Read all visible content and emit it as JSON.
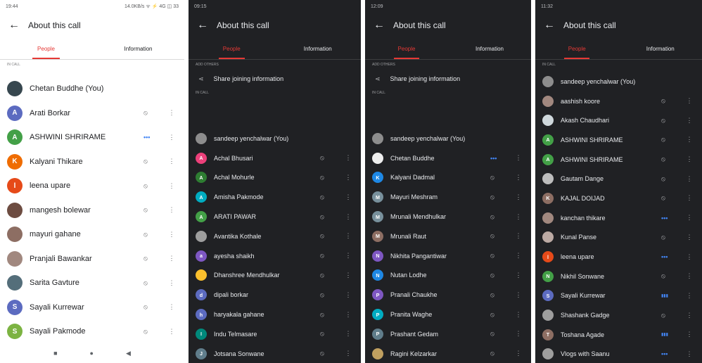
{
  "screens": [
    {
      "theme": "light",
      "status_left": "19:44",
      "status_right": "14.0KB/s ᯤ ⚡ 4G ◫ 33",
      "title": "About this call",
      "tabs": [
        "People",
        "Information"
      ],
      "share_label": "",
      "section_top": "IN CALL",
      "section_in_call": "",
      "participants": [
        {
          "name": "Chetan Buddhe (You)",
          "initial": "",
          "color": "#37474f",
          "status": ""
        },
        {
          "name": "Arati Borkar",
          "initial": "A",
          "color": "#5c6bc0",
          "status": "muted"
        },
        {
          "name": "ASHWINI SHRIRAME",
          "initial": "A",
          "color": "#43a047",
          "status": "speaking"
        },
        {
          "name": "Kalyani Thikare",
          "initial": "K",
          "color": "#ef6c00",
          "status": "muted"
        },
        {
          "name": "leena upare",
          "initial": "l",
          "color": "#e64a19",
          "status": "muted"
        },
        {
          "name": "mangesh bolewar",
          "initial": "",
          "color": "#6d4c41",
          "status": "muted"
        },
        {
          "name": "mayuri gahane",
          "initial": "",
          "color": "#8d6e63",
          "status": "muted"
        },
        {
          "name": "Pranjali Bawankar",
          "initial": "",
          "color": "#a1887f",
          "status": "muted"
        },
        {
          "name": "Sarita Gavture",
          "initial": "",
          "color": "#546e7a",
          "status": "muted"
        },
        {
          "name": "Sayali Kurrewar",
          "initial": "S",
          "color": "#5c6bc0",
          "status": "muted"
        },
        {
          "name": "Sayali Pakmode",
          "initial": "S",
          "color": "#7cb342",
          "status": "muted"
        }
      ]
    },
    {
      "theme": "dark",
      "status_left": "09:15",
      "status_right": "",
      "title": "About this call",
      "tabs": [
        "People",
        "Information"
      ],
      "section_top": "ADD OTHERS",
      "share_label": "Share joining information",
      "section_in_call": "IN CALL",
      "participants": [
        {
          "name": "sandeep yenchalwar (You)",
          "initial": "",
          "color": "#8d8d8d",
          "status": ""
        },
        {
          "name": "Achal Bhusari",
          "initial": "A",
          "color": "#ec407a",
          "status": "muted"
        },
        {
          "name": "Achal Mohurle",
          "initial": "A",
          "color": "#2e7d32",
          "status": "muted"
        },
        {
          "name": "Amisha Pakmode",
          "initial": "A",
          "color": "#00acc1",
          "status": "muted"
        },
        {
          "name": "ARATI PAWAR",
          "initial": "A",
          "color": "#43a047",
          "status": "muted"
        },
        {
          "name": "Avantika Kothale",
          "initial": "",
          "color": "#9e9e9e",
          "status": "muted"
        },
        {
          "name": "ayesha shaikh",
          "initial": "a",
          "color": "#7e57c2",
          "status": "muted"
        },
        {
          "name": "Dhanshree Mendhulkar",
          "initial": "",
          "color": "#fbc02d",
          "status": "muted"
        },
        {
          "name": "dipali borkar",
          "initial": "d",
          "color": "#5c6bc0",
          "status": "muted"
        },
        {
          "name": "haryakala gahane",
          "initial": "h",
          "color": "#5c6bc0",
          "status": "muted"
        },
        {
          "name": "Indu Telmasare",
          "initial": "I",
          "color": "#00897b",
          "status": "muted"
        },
        {
          "name": "Jotsana Sonwane",
          "initial": "J",
          "color": "#607d8b",
          "status": "muted"
        }
      ]
    },
    {
      "theme": "dark",
      "status_left": "12:09",
      "status_right": "",
      "title": "About this call",
      "tabs": [
        "People",
        "Information"
      ],
      "section_top": "ADD OTHERS",
      "share_label": "Share joining information",
      "section_in_call": "IN CALL",
      "participants": [
        {
          "name": "sandeep yenchalwar (You)",
          "initial": "",
          "color": "#8d8d8d",
          "status": ""
        },
        {
          "name": "Chetan Buddhe",
          "initial": "",
          "color": "#eeeeee",
          "status": "speaking"
        },
        {
          "name": "Kalyani Dadmal",
          "initial": "K",
          "color": "#1e88e5",
          "status": "muted"
        },
        {
          "name": "Mayuri Meshram",
          "initial": "M",
          "color": "#78909c",
          "status": "muted"
        },
        {
          "name": "Mrunali Mendhulkar",
          "initial": "M",
          "color": "#78909c",
          "status": "muted"
        },
        {
          "name": "Mrunali Raut",
          "initial": "M",
          "color": "#8d6e63",
          "status": "muted"
        },
        {
          "name": "Nikhita Pangantiwar",
          "initial": "N",
          "color": "#7e57c2",
          "status": "muted"
        },
        {
          "name": "Nutan Lodhe",
          "initial": "N",
          "color": "#1e88e5",
          "status": "muted"
        },
        {
          "name": "Pranali Chaukhe",
          "initial": "P",
          "color": "#7e57c2",
          "status": "muted"
        },
        {
          "name": "Pranita Waghe",
          "initial": "P",
          "color": "#00acc1",
          "status": "muted"
        },
        {
          "name": "Prashant Gedam",
          "initial": "P",
          "color": "#607d8b",
          "status": "muted"
        },
        {
          "name": "Ragini Kelzarkar",
          "initial": "",
          "color": "#c0a060",
          "status": "muted"
        }
      ]
    },
    {
      "theme": "dark",
      "status_left": "11:32",
      "status_right": "",
      "title": "About this call",
      "tabs": [
        "People",
        "Information"
      ],
      "share_label": "",
      "section_top": "IN CALL",
      "section_in_call": "",
      "participants": [
        {
          "name": "sandeep yenchalwar (You)",
          "initial": "",
          "color": "#8d8d8d",
          "status": ""
        },
        {
          "name": "aashish koore",
          "initial": "",
          "color": "#a1887f",
          "status": "muted"
        },
        {
          "name": "Akash Chaudhari",
          "initial": "",
          "color": "#cfd8dc",
          "status": "muted"
        },
        {
          "name": "ASHWINI SHRIRAME",
          "initial": "A",
          "color": "#43a047",
          "status": "muted"
        },
        {
          "name": "ASHWINI SHRIRAME",
          "initial": "A",
          "color": "#43a047",
          "status": "muted"
        },
        {
          "name": "Gautam Dange",
          "initial": "",
          "color": "#bdbdbd",
          "status": "muted"
        },
        {
          "name": "KAJAL DOIJAD",
          "initial": "K",
          "color": "#8d6e63",
          "status": "muted"
        },
        {
          "name": "kanchan thikare",
          "initial": "",
          "color": "#a1887f",
          "status": "speaking"
        },
        {
          "name": "Kunal Panse",
          "initial": "",
          "color": "#bcaaa4",
          "status": "muted"
        },
        {
          "name": "leena upare",
          "initial": "l",
          "color": "#e64a19",
          "status": "speaking"
        },
        {
          "name": "Nikhil Sonwane",
          "initial": "N",
          "color": "#43a047",
          "status": "muted"
        },
        {
          "name": "Sayali Kurrewar",
          "initial": "S",
          "color": "#5c6bc0",
          "status": "bars"
        },
        {
          "name": "Shashank Gadge",
          "initial": "",
          "color": "#9e9e9e",
          "status": "muted"
        },
        {
          "name": "Toshana Agade",
          "initial": "T",
          "color": "#8d6e63",
          "status": "bars"
        },
        {
          "name": "Vlogs with Saanu",
          "initial": "",
          "color": "#9e9e9e",
          "status": "speaking"
        }
      ]
    }
  ],
  "nav": [
    "■",
    "●",
    "◀"
  ],
  "accent": "#e53935"
}
